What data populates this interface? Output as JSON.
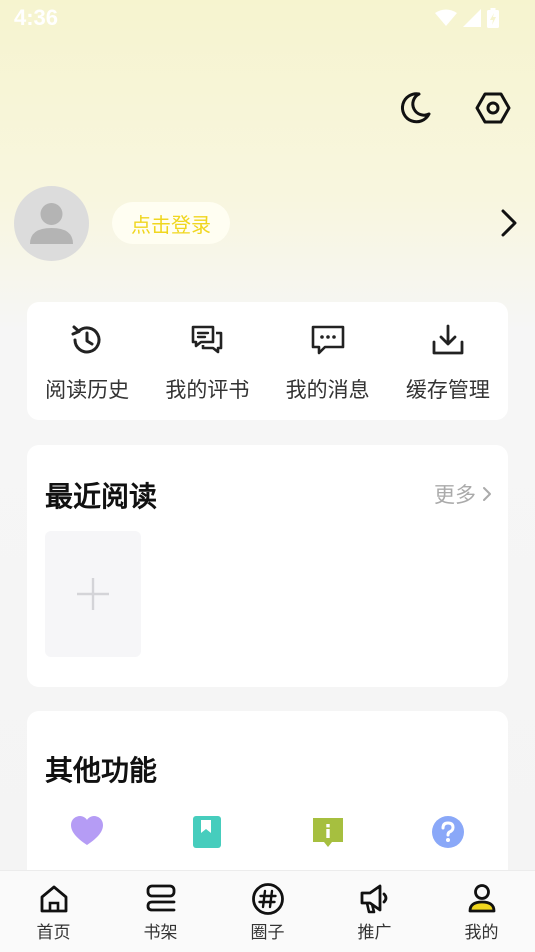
{
  "status": {
    "time": "4:36"
  },
  "profile": {
    "login_label": "点击登录"
  },
  "quick_actions": [
    {
      "label": "阅读历史",
      "icon": "history-icon"
    },
    {
      "label": "我的评书",
      "icon": "reviews-icon"
    },
    {
      "label": "我的消息",
      "icon": "message-icon"
    },
    {
      "label": "缓存管理",
      "icon": "download-icon"
    }
  ],
  "recent": {
    "title": "最近阅读",
    "more": "更多"
  },
  "other": {
    "title": "其他功能",
    "icons": [
      "heart-icon",
      "bookmark-icon",
      "notice-icon",
      "help-icon"
    ]
  },
  "nav": [
    {
      "label": "首页",
      "icon": "home-icon"
    },
    {
      "label": "书架",
      "icon": "bookshelf-icon"
    },
    {
      "label": "圈子",
      "icon": "hashtag-icon"
    },
    {
      "label": "推广",
      "icon": "megaphone-icon"
    },
    {
      "label": "我的",
      "icon": "user-icon"
    }
  ],
  "colors": {
    "accent": "#f0d61f",
    "purple": "#b59cf5",
    "teal": "#46cdbd",
    "olive": "#a6bf3f",
    "blue": "#8aa8f8"
  }
}
